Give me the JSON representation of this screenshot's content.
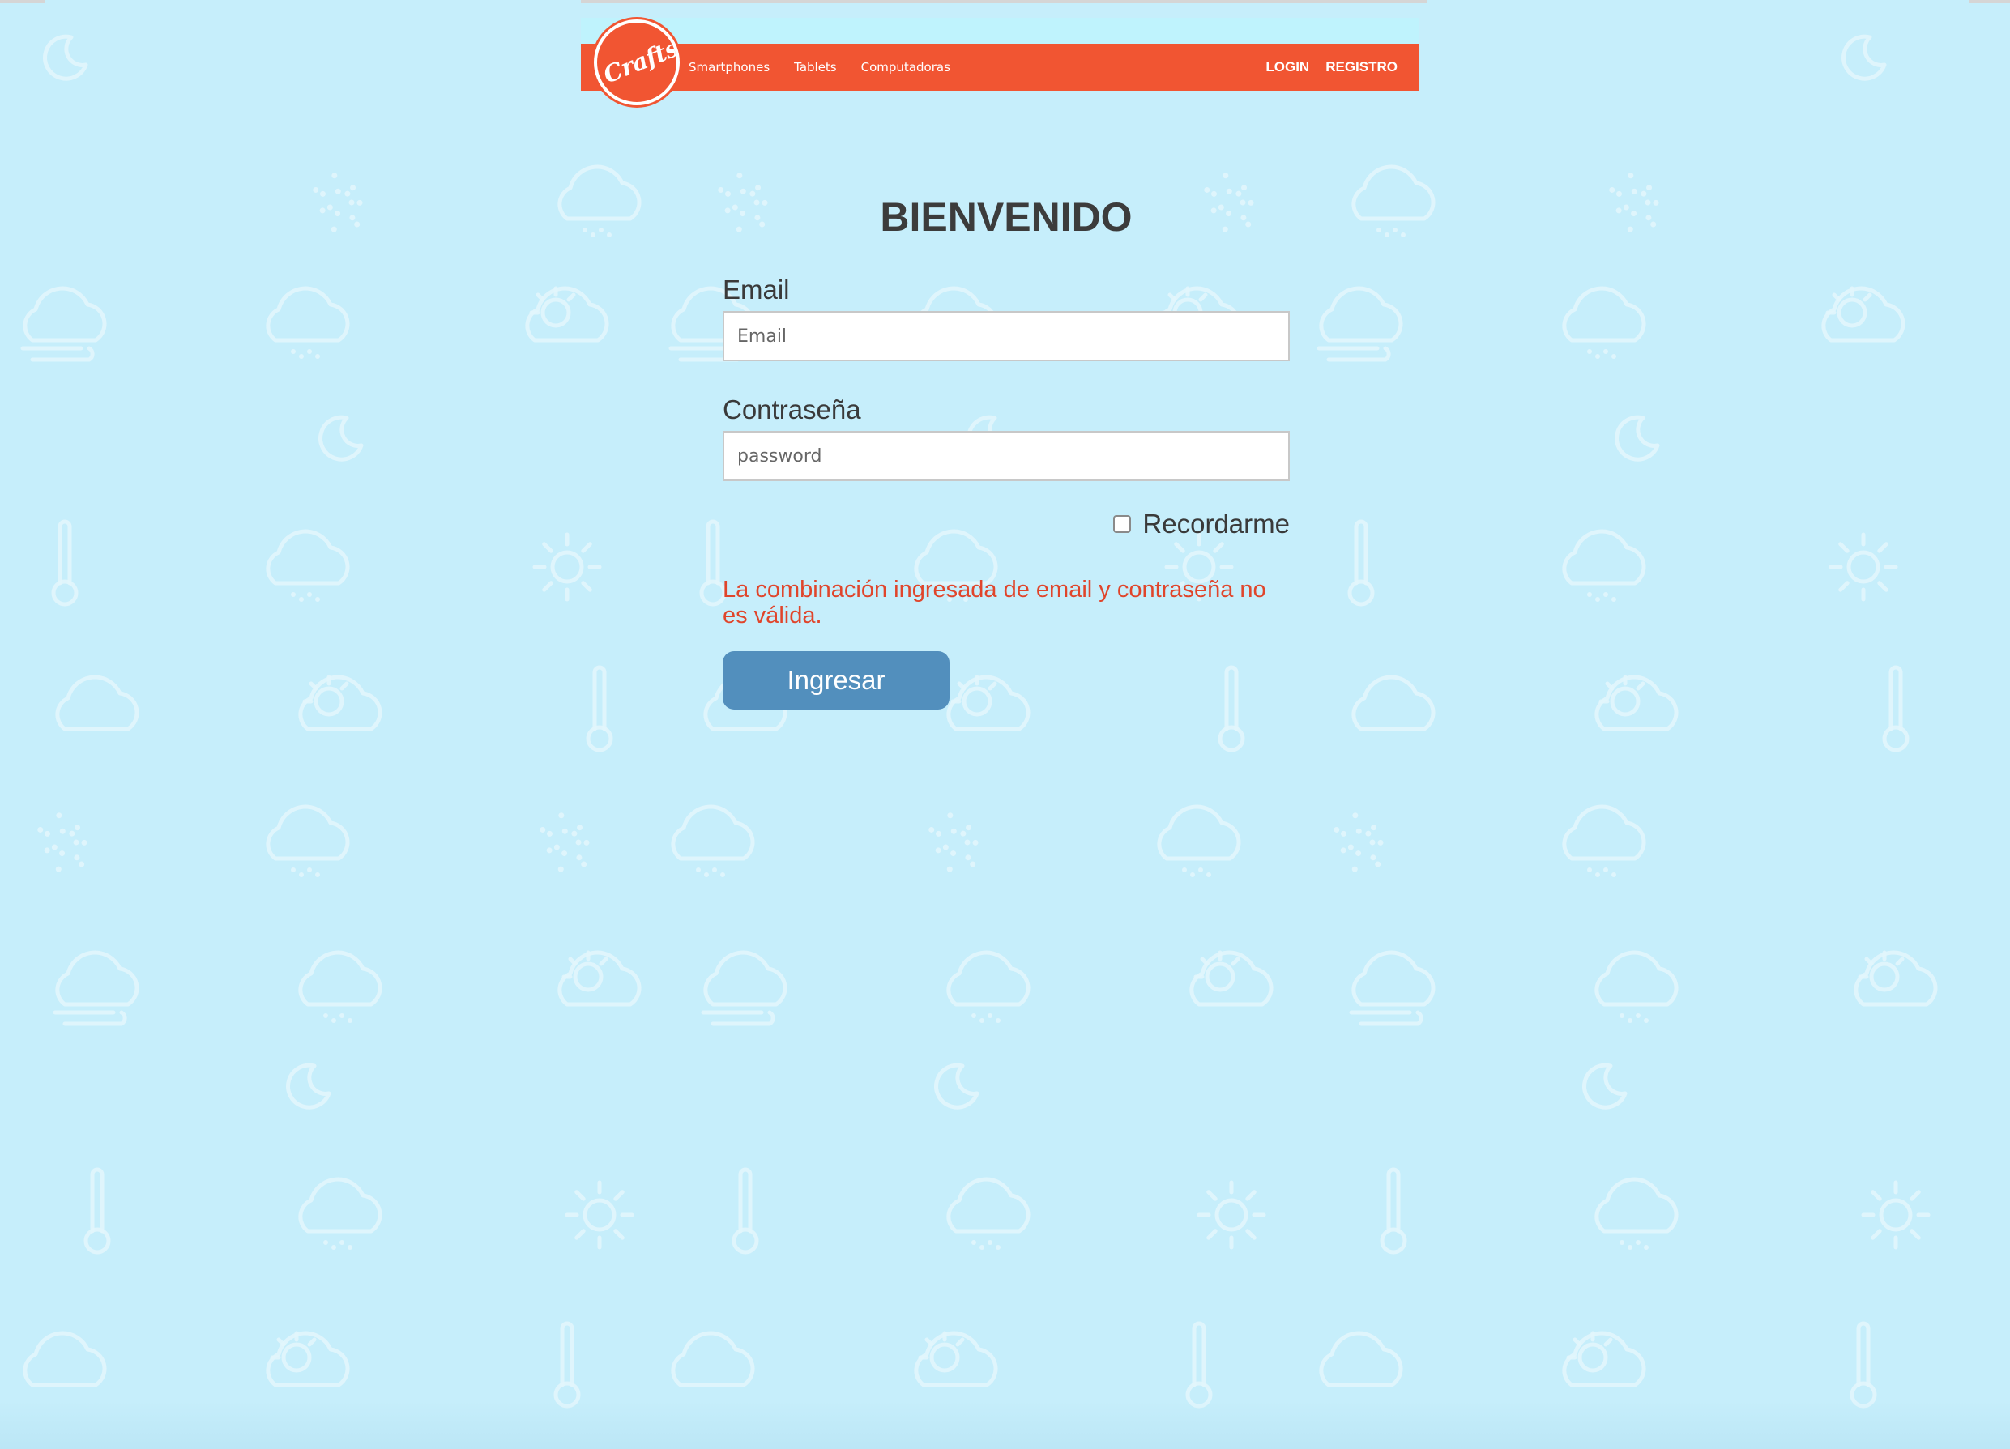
{
  "brand": {
    "logo_text": "Craftsy"
  },
  "nav": {
    "links": [
      "Smartphones",
      "Tablets",
      "Computadoras"
    ],
    "login": "LOGIN",
    "register": "REGISTRO"
  },
  "form": {
    "title": "BIENVENIDO",
    "email_label": "Email",
    "email_placeholder": "Email",
    "password_label": "Contraseña",
    "password_placeholder": "password",
    "remember_label": "Recordarme",
    "error": "La combinación ingresada de email y contraseña no es válida.",
    "submit": "Ingresar"
  },
  "colors": {
    "background": "#c6eefb",
    "navbar": "#f15532",
    "button": "#528fbd",
    "error": "#e0452b"
  }
}
